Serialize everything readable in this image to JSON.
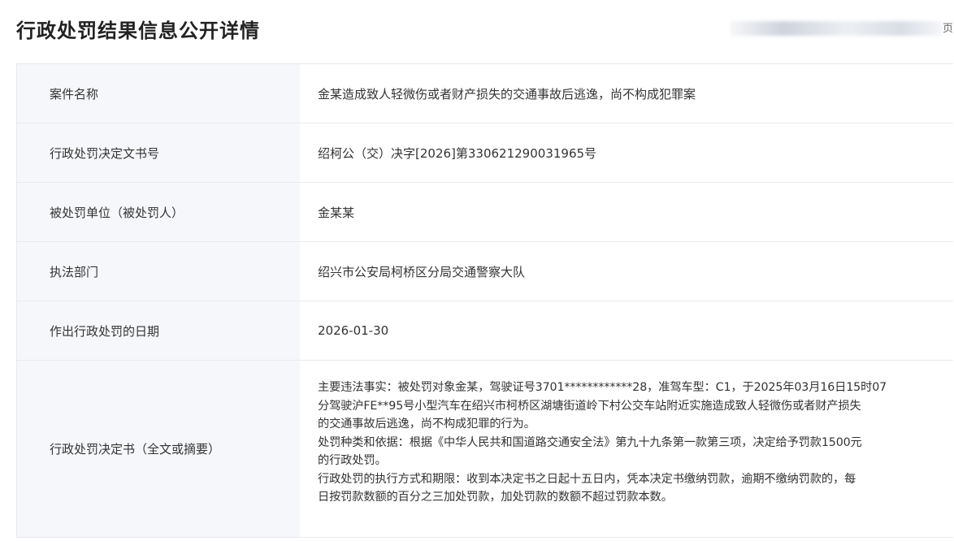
{
  "page": {
    "title": "行政处罚结果信息公开详情",
    "header_fragment": "页"
  },
  "rows": [
    {
      "label": "案件名称",
      "value": "金某造成致人轻微伤或者财产损失的交通事故后逃逸，尚不构成犯罪案"
    },
    {
      "label": "行政处罚决定文书号",
      "value": "绍柯公（交）决字[2026]第330621290031965号"
    },
    {
      "label": "被处罚单位（被处罚人）",
      "value": "金某某"
    },
    {
      "label": "执法部门",
      "value": "绍兴市公安局柯桥区分局交通警察大队"
    },
    {
      "label": "作出行政处罚的日期",
      "value": "2026-01-30"
    }
  ],
  "decision": {
    "label": "行政处罚决定书（全文或摘要）",
    "lines": [
      "主要违法事实：被处罚对象金某，驾驶证号3701************28，准驾车型：C1，于2025年03月16日15时07",
      "分驾驶沪FE**95号小型汽车在绍兴市柯桥区湖塘街道岭下村公交车站附近实施造成致人轻微伤或者财产损失",
      "的交通事故后逃逸，尚不构成犯罪的行为。",
      "处罚种类和依据：根据《中华人民共和国道路交通安全法》第九十九条第一款第三项，决定给予罚款1500元",
      "的行政处罚。",
      "行政处罚的执行方式和期限：收到本决定书之日起十五日内，凭本决定书缴纳罚款，逾期不缴纳罚款的，每",
      "日按罚款数额的百分之三加处罚款，加处罚款的数额不超过罚款本数。"
    ]
  }
}
